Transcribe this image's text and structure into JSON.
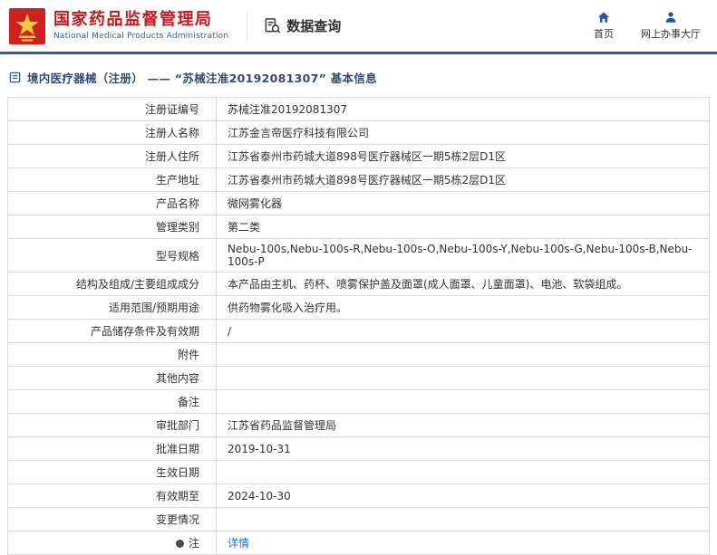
{
  "header": {
    "agency_name_cn": "国家药品监督管理局",
    "agency_name_en": "National Medical Products Administration",
    "module_title": "数据查询",
    "nav": {
      "home": "首页",
      "service_hall": "网上办事大厅"
    }
  },
  "breadcrumb": {
    "text": "境内医疗器械（注册） ——  “苏械注准20192081307” 基本信息"
  },
  "record": {
    "rows": [
      {
        "label": "注册证编号",
        "value": "苏械注准20192081307"
      },
      {
        "label": "注册人名称",
        "value": "江苏金言帝医疗科技有限公司"
      },
      {
        "label": "注册人住所",
        "value": "江苏省泰州市药城大道898号医疗器械区一期5栋2层D1区"
      },
      {
        "label": "生产地址",
        "value": "江苏省泰州市药城大道898号医疗器械区一期5栋2层D1区"
      },
      {
        "label": "产品名称",
        "value": "微网雾化器"
      },
      {
        "label": "管理类别",
        "value": "第二类"
      },
      {
        "label": "型号规格",
        "value": "Nebu-100s,Nebu-100s-R,Nebu-100s-O,Nebu-100s-Y,Nebu-100s-G,Nebu-100s-B,Nebu-100s-P"
      },
      {
        "label": "结构及组成/主要组成成分",
        "value": "本产品由主机、药杯、喷雾保护盖及面罩(成人面罩、儿童面罩)、电池、软袋组成。"
      },
      {
        "label": "适用范围/预期用途",
        "value": "供药物雾化吸入治疗用。"
      },
      {
        "label": "产品储存条件及有效期",
        "value": "/"
      },
      {
        "label": "附件",
        "value": ""
      },
      {
        "label": "其他内容",
        "value": ""
      },
      {
        "label": "备注",
        "value": ""
      },
      {
        "label": "审批部门",
        "value": "江苏省药品监督管理局"
      },
      {
        "label": "批准日期",
        "value": "2019-10-31"
      },
      {
        "label": "生效日期",
        "value": ""
      },
      {
        "label": "有效期至",
        "value": "2024-10-30"
      },
      {
        "label": "变更情况",
        "value": ""
      },
      {
        "label": "注",
        "value": "详情"
      }
    ]
  },
  "colors": {
    "brand_red": "#c6171e",
    "brand_blue": "#2464a8",
    "header_rule_blue": "#2d5f9e",
    "nav_icon_blue": "#2458a6",
    "link_blue": "#1a6ecc",
    "breadcrumb_navy": "#33497a",
    "table_border": "#d9d9d9"
  }
}
